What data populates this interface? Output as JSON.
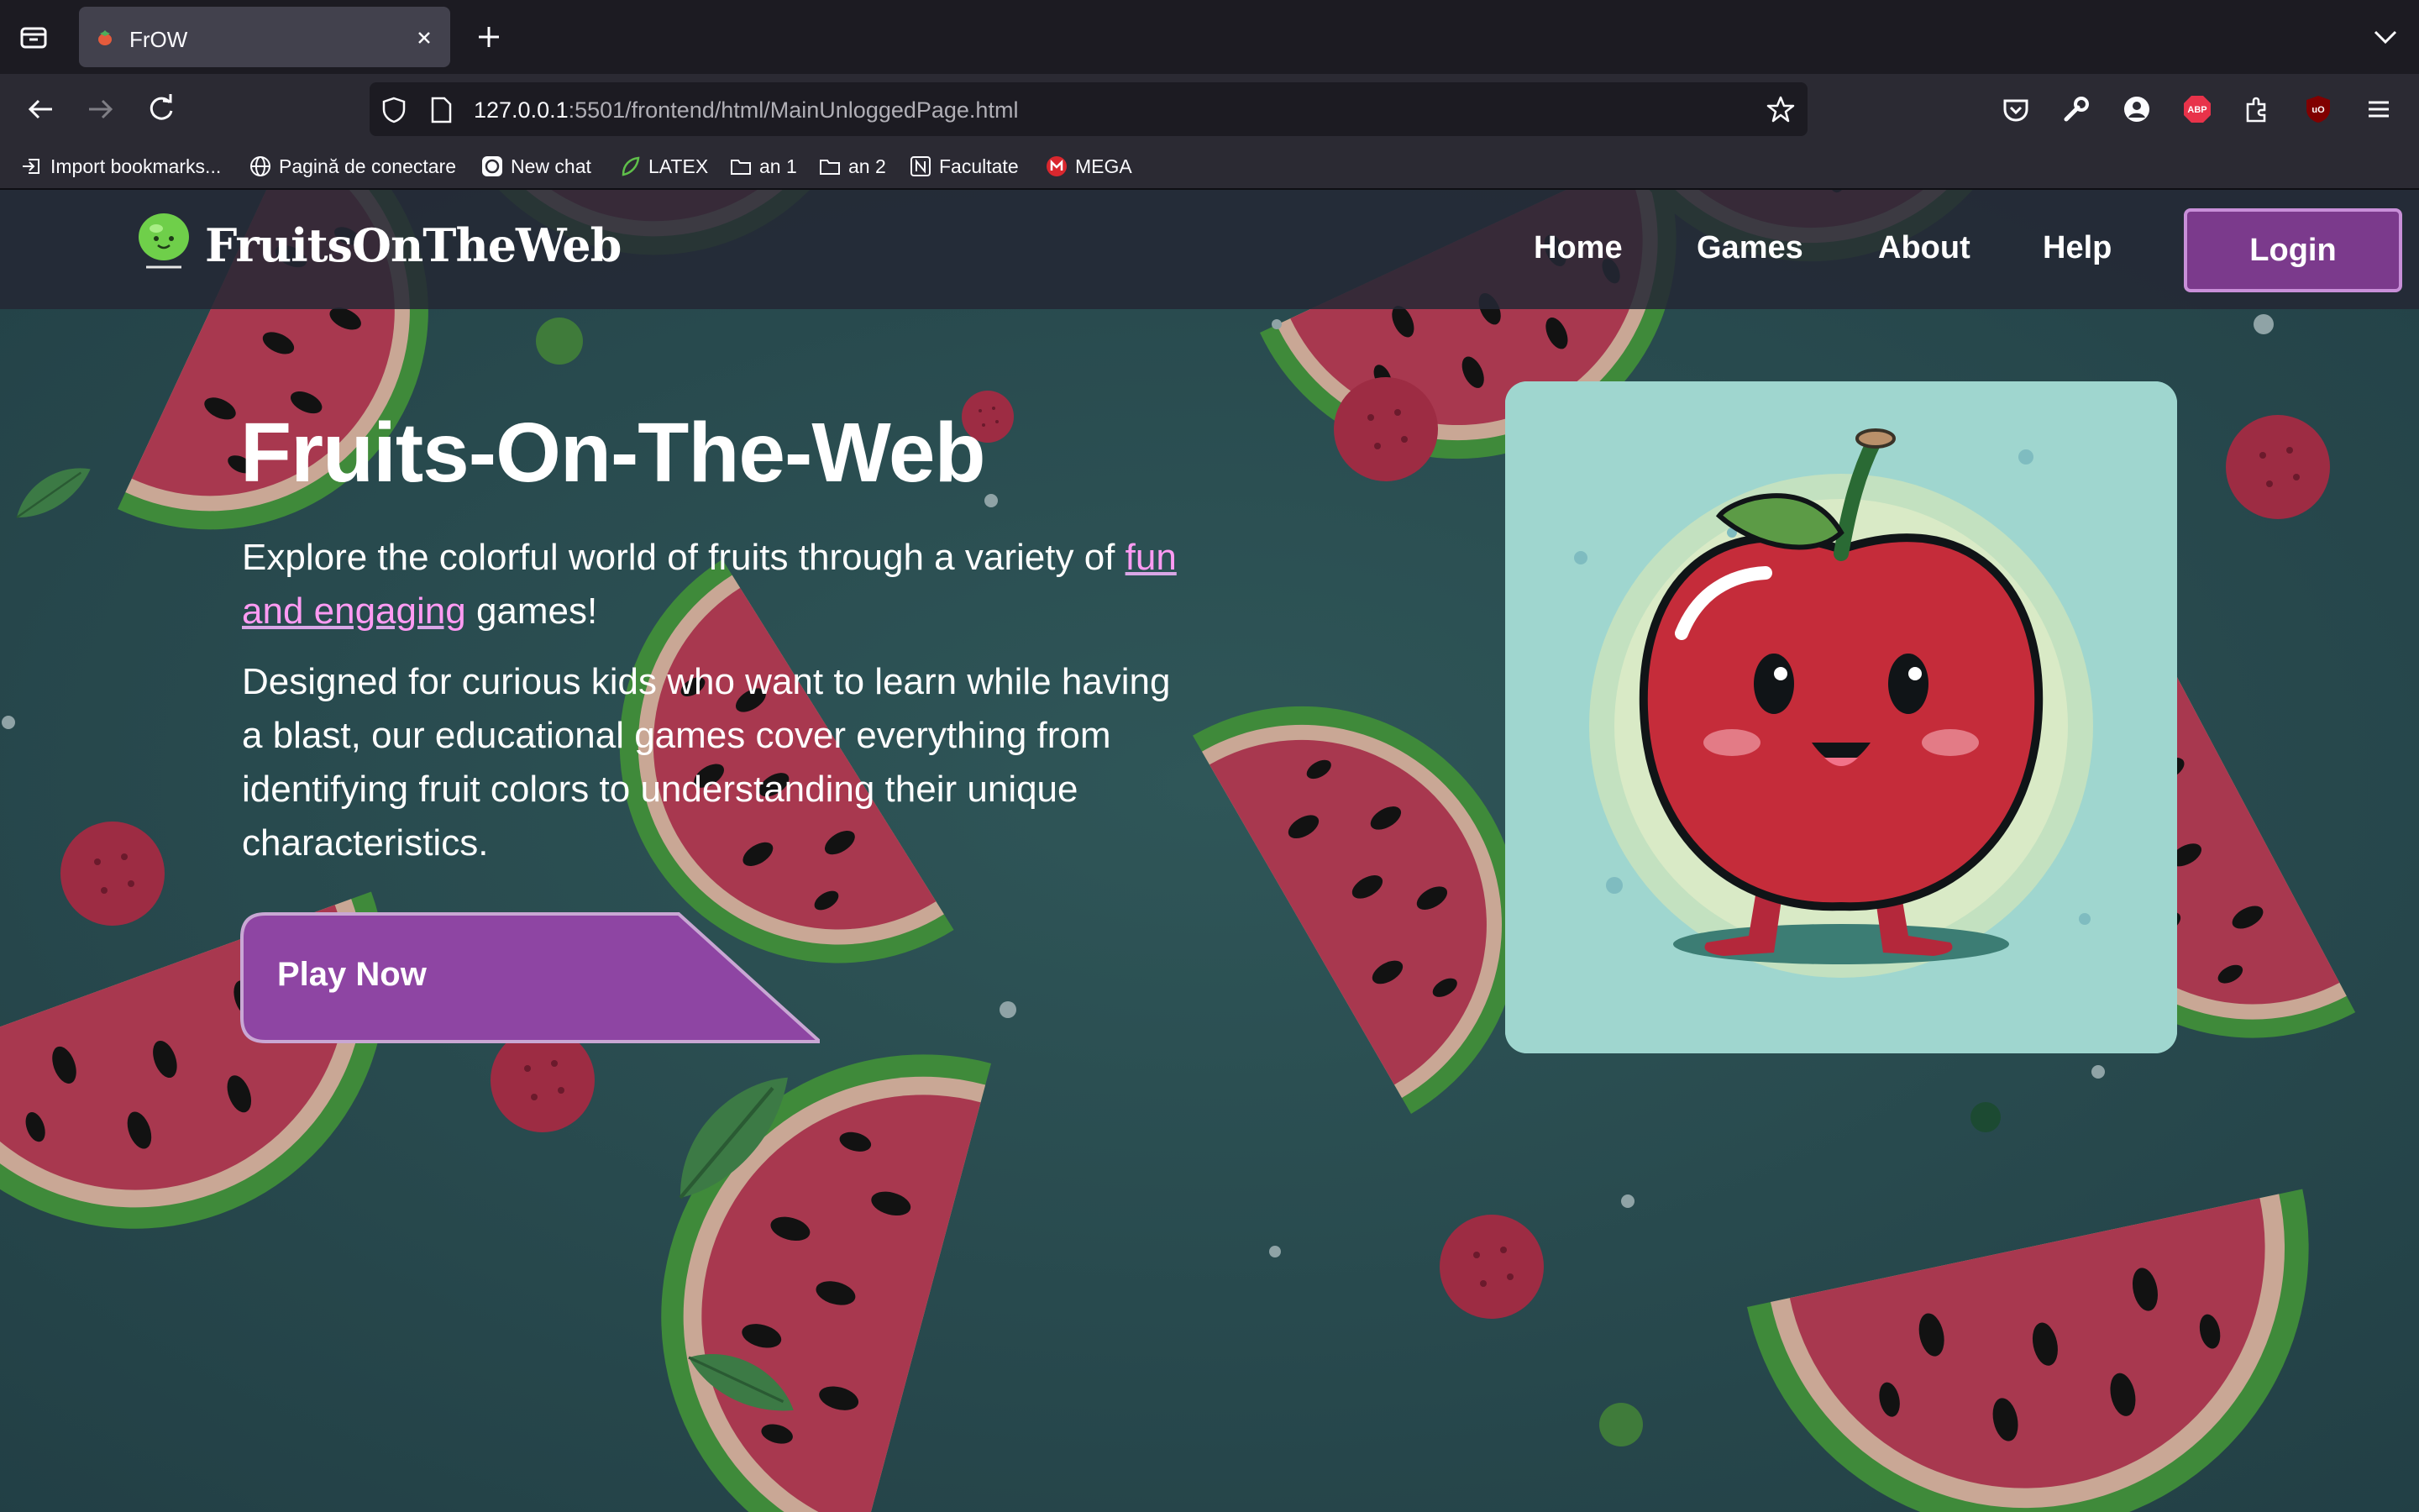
{
  "browser": {
    "tab": {
      "title": "FrOW"
    },
    "url": {
      "host": "127.0.0.1",
      "rest": ":5501/frontend/html/MainUnloggedPage.html"
    },
    "bookmarks": [
      {
        "label": "Import bookmarks...",
        "icon": "import-icon"
      },
      {
        "label": "Pagină de conectare",
        "icon": "globe-icon"
      },
      {
        "label": "New chat",
        "icon": "chatgpt-icon"
      },
      {
        "label": "LATEX",
        "icon": "leaf-icon"
      },
      {
        "label": "an 1",
        "icon": "folder-icon"
      },
      {
        "label": "an 2",
        "icon": "folder-icon"
      },
      {
        "label": "Facultate",
        "icon": "notion-icon"
      },
      {
        "label": "MEGA",
        "icon": "mega-icon"
      }
    ],
    "extensions": [
      {
        "icon": "pocket-icon"
      },
      {
        "icon": "wrench-icon"
      },
      {
        "icon": "account-icon"
      },
      {
        "icon": "adblock-plus-icon",
        "text": "ABP"
      },
      {
        "icon": "extensions-icon"
      },
      {
        "icon": "ublock-icon",
        "text": "uO"
      },
      {
        "icon": "menu-icon"
      }
    ]
  },
  "site": {
    "logo_text": "FruitsOnTheWeb",
    "nav": [
      "Home",
      "Games",
      "About",
      "Help"
    ],
    "login_label": "Login"
  },
  "hero": {
    "title": "Fruits-On-The-Web",
    "p1_before": "Explore the colorful world of fruits through a variety of ",
    "p1_highlight": "fun and engaging",
    "p1_after": " games!",
    "p2": "Designed for curious kids who want to learn while having a blast, our educational games cover everything from identifying fruit colors to understanding their unique characteristics.",
    "cta_label": "Play Now"
  },
  "colors": {
    "accent_purple": "#7b3a8c",
    "button_purple": "#8e45a3",
    "highlight_pink": "#ff9bf3",
    "page_bg": "#2a4d4f"
  }
}
